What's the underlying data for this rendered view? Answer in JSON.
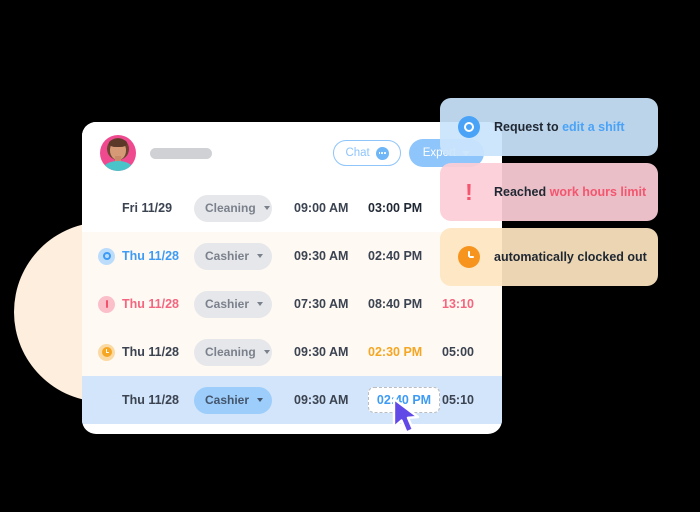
{
  "header": {
    "avatar_alt": "employee-avatar",
    "name_redacted": "",
    "chat_label": "Chat",
    "chat_icon": "chat-bubble-icon",
    "export_label": "Export",
    "export_caret": "chevron-down-icon"
  },
  "table": {
    "rows": [
      {
        "status_icon": "none",
        "date": "Fri 11/29",
        "date_style": "default",
        "role": "Cleaning",
        "role_active": false,
        "clock_in": "09:00 AM",
        "clock_out": "03:00 PM",
        "clock_out_style": "strong",
        "duration": "",
        "duration_style": "empty",
        "selected": false,
        "editing": false
      },
      {
        "status_icon": "request-edit-icon",
        "date": "Thu 11/28",
        "date_style": "blue",
        "role": "Cashier",
        "role_active": false,
        "clock_in": "09:30 AM",
        "clock_out": "02:40 PM",
        "clock_out_style": "default",
        "duration": "",
        "duration_style": "empty",
        "selected": false,
        "editing": false
      },
      {
        "status_icon": "alert-icon",
        "date": "Thu 11/28",
        "date_style": "pink",
        "role": "Cashier",
        "role_active": false,
        "clock_in": "07:30 AM",
        "clock_out": "08:40 PM",
        "clock_out_style": "default",
        "duration": "13:10",
        "duration_style": "red",
        "selected": false,
        "editing": false
      },
      {
        "status_icon": "auto-clockout-icon",
        "date": "Thu 11/28",
        "date_style": "default",
        "role": "Cleaning",
        "role_active": false,
        "clock_in": "09:30 AM",
        "clock_out": "02:30 PM",
        "clock_out_style": "orange",
        "duration": "05:00",
        "duration_style": "default",
        "selected": false,
        "editing": false
      },
      {
        "status_icon": "none",
        "date": "Thu 11/28",
        "date_style": "default",
        "role": "Cashier",
        "role_active": true,
        "clock_in": "09:30 AM",
        "clock_out": "02:40 PM",
        "clock_out_style": "editing",
        "duration": "05:10",
        "duration_style": "default",
        "selected": true,
        "editing": true
      }
    ]
  },
  "toasts": [
    {
      "icon": "request-edit-icon",
      "text_plain": "Request to ",
      "text_highlight": "edit a shift",
      "highlight_color": "#4aa3f7",
      "background": "#cae4fc",
      "variant": "blue"
    },
    {
      "icon": "alert-icon",
      "text_plain": "Reached ",
      "text_highlight": "work hours limit",
      "highlight_color": "#f4566f",
      "background": "#fccdd6",
      "variant": "pink"
    },
    {
      "icon": "auto-clockout-icon",
      "text_plain": "automatically clocked out",
      "text_highlight": "",
      "highlight_color": "",
      "background": "#fde5bf",
      "variant": "orange"
    }
  ],
  "cursor": {
    "name": "mouse-pointer",
    "color": "#6149e8"
  },
  "colors": {
    "accent_blue": "#8ec5fb",
    "alert_red": "#f4566f",
    "warn_orange": "#f7941e",
    "selected_row": "#d3e5fa",
    "peach_circle": "#fdeedd",
    "card_white": "#ffffff",
    "page_background": "#000000"
  }
}
